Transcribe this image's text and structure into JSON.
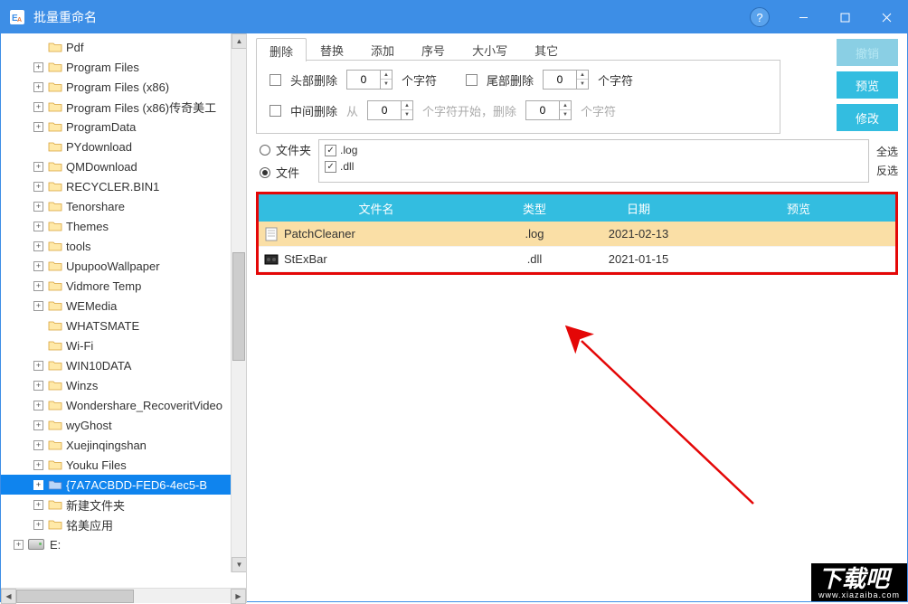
{
  "window": {
    "title": "批量重命名"
  },
  "sidebar": {
    "items": [
      {
        "label": "Pdf",
        "expander": ""
      },
      {
        "label": "Program Files",
        "expander": "+"
      },
      {
        "label": "Program Files (x86)",
        "expander": "+"
      },
      {
        "label": "Program Files (x86)传奇美工",
        "expander": "+"
      },
      {
        "label": "ProgramData",
        "expander": "+"
      },
      {
        "label": "PYdownload",
        "expander": ""
      },
      {
        "label": "QMDownload",
        "expander": "+"
      },
      {
        "label": "RECYCLER.BIN1",
        "expander": "+"
      },
      {
        "label": "Tenorshare",
        "expander": "+"
      },
      {
        "label": "Themes",
        "expander": "+"
      },
      {
        "label": "tools",
        "expander": "+"
      },
      {
        "label": "UpupooWallpaper",
        "expander": "+"
      },
      {
        "label": "Vidmore Temp",
        "expander": "+"
      },
      {
        "label": "WEMedia",
        "expander": "+"
      },
      {
        "label": "WHATSMATE",
        "expander": ""
      },
      {
        "label": "Wi-Fi",
        "expander": ""
      },
      {
        "label": "WIN10DATA",
        "expander": "+"
      },
      {
        "label": "Winzs",
        "expander": "+"
      },
      {
        "label": "Wondershare_RecoveritVideo",
        "expander": "+"
      },
      {
        "label": "wyGhost",
        "expander": "+"
      },
      {
        "label": "Xuejinqingshan",
        "expander": "+"
      },
      {
        "label": "Youku Files",
        "expander": "+"
      },
      {
        "label": "{7A7ACBDD-FED6-4ec5-B",
        "expander": "+",
        "selected": true,
        "folderVariant": "blue"
      },
      {
        "label": "新建文件夹",
        "expander": "+"
      },
      {
        "label": "铭美应用",
        "expander": "+"
      }
    ],
    "drive": {
      "label": "E:",
      "expander": "+"
    }
  },
  "tabs": {
    "items": [
      "删除",
      "替换",
      "添加",
      "序号",
      "大小写",
      "其它"
    ],
    "active": 0
  },
  "deletePanel": {
    "headLabel": "头部删除",
    "headValue": "0",
    "headUnit": "个字符",
    "tailLabel": "尾部删除",
    "tailValue": "0",
    "tailUnit": "个字符",
    "midLabel": "中间删除",
    "midFrom": "从",
    "midFromValue": "0",
    "midMid": "个字符开始，删除",
    "midToValue": "0",
    "midUnit": "个字符"
  },
  "actions": {
    "undo": "撤销",
    "preview": "预览",
    "apply": "修改"
  },
  "filter": {
    "radioFolder": "文件夹",
    "radioFile": "文件",
    "radioSelected": "file",
    "exts": [
      ".log",
      ".dll"
    ],
    "selectAll": "全选",
    "selectInverse": "反选"
  },
  "table": {
    "headers": {
      "name": "文件名",
      "type": "类型",
      "date": "日期",
      "preview": "预览"
    },
    "rows": [
      {
        "name": "PatchCleaner",
        "type": ".log",
        "date": "2021-02-13",
        "selected": true,
        "icon": "doc"
      },
      {
        "name": "StExBar",
        "type": ".dll",
        "date": "2021-01-15",
        "selected": false,
        "icon": "dll"
      }
    ]
  },
  "watermark": {
    "big": "下载吧",
    "small": "www.xiazaiba.com"
  }
}
